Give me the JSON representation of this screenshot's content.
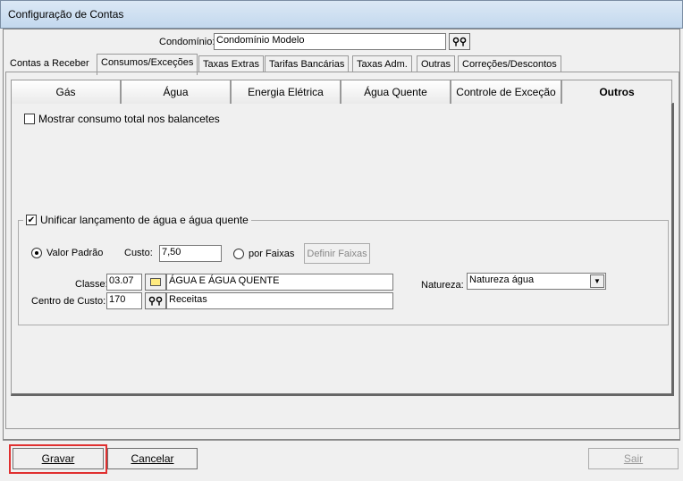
{
  "window": {
    "title": "Configuração de Contas"
  },
  "condominio": {
    "label": "Condomínio:",
    "value": "Condomínio Modelo"
  },
  "main_tabs": [
    "Contas a Receber",
    "Consumos/Exceções",
    "Taxas Extras",
    "Tarifas Bancárias",
    "Taxas Adm.",
    "Outras",
    "Correções/Descontos"
  ],
  "sub_tabs": [
    "Gás",
    "Água",
    "Energia Elétrica",
    "Água Quente",
    "Controle de Exceção",
    "Outros"
  ],
  "outros": {
    "mostrar_label": "Mostrar consumo total nos balancetes",
    "mostrar_checked": false,
    "unificar_label": "Unificar lançamento de água e água quente",
    "unificar_checked": true,
    "valor_padrao_label": "Valor Padrão",
    "custo_label": "Custo:",
    "custo_value": "7,50",
    "por_faixas_label": "por Faixas",
    "definir_faixas_label": "Definir Faixas",
    "classe_label": "Classe:",
    "classe_code": "03.07",
    "classe_desc": "ÁGUA E ÁGUA QUENTE",
    "centro_label": "Centro de Custo:",
    "centro_code": "170",
    "centro_desc": "Receitas",
    "natureza_label": "Natureza:",
    "natureza_value": "Natureza água"
  },
  "footer": {
    "gravar": "Gravar",
    "cancelar": "Cancelar",
    "sair": "Sair"
  }
}
